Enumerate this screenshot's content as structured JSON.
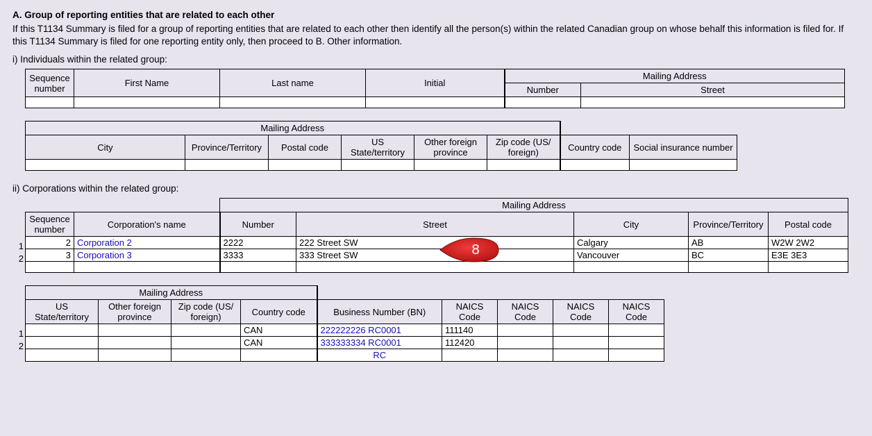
{
  "sectionA": {
    "heading": "A. Group of reporting entities that are related to each other",
    "description": "If this T1134 Summary is filed for a group of reporting entities that are related to each other then identify all the person(s) within the related Canadian group on whose behalf this information is filed for. If this T1134 Summary is filed for one reporting entity only, then proceed to B. Other information.",
    "sub_i": "i) Individuals within the related group:",
    "sub_ii": "ii) Corporations within the related group:"
  },
  "headers": {
    "mailing_address": "Mailing Address",
    "seq_num": "Sequence number",
    "first_name": "First Name",
    "last_name": "Last name",
    "initial": "Initial",
    "number": "Number",
    "street": "Street",
    "city": "City",
    "prov_terr": "Province/Territory",
    "postal": "Postal code",
    "us_state": "US State/territory",
    "other_foreign": "Other foreign province",
    "zip": "Zip code (US/ foreign)",
    "country_code": "Country code",
    "sin": "Social insurance number",
    "corp_name": "Corporation's name",
    "bn": "Business Number (BN)",
    "naics": "NAICS Code"
  },
  "corporations": {
    "row_labels": [
      "1",
      "2"
    ],
    "rows": [
      {
        "seq": "2",
        "name": "Corporation 2",
        "number": "2222",
        "street": "222 Street SW",
        "city": "Calgary",
        "prov": "AB",
        "postal": "W2W 2W2",
        "us_state": "",
        "other_foreign": "",
        "zip": "",
        "country": "CAN",
        "bn": "222222226 RC0001",
        "naics1": "111140",
        "naics2": "",
        "naics3": "",
        "naics4": ""
      },
      {
        "seq": "3",
        "name": "Corporation 3",
        "number": "3333",
        "street": "333 Street SW",
        "city": "Vancouver",
        "prov": "BC",
        "postal": "E3E 3E3",
        "us_state": "",
        "other_foreign": "",
        "zip": "",
        "country": "CAN",
        "bn": "333333334 RC0001",
        "naics1": "112420",
        "naics2": "",
        "naics3": "",
        "naics4": ""
      }
    ],
    "footer_bn": "RC"
  },
  "callout": {
    "label": "8"
  }
}
